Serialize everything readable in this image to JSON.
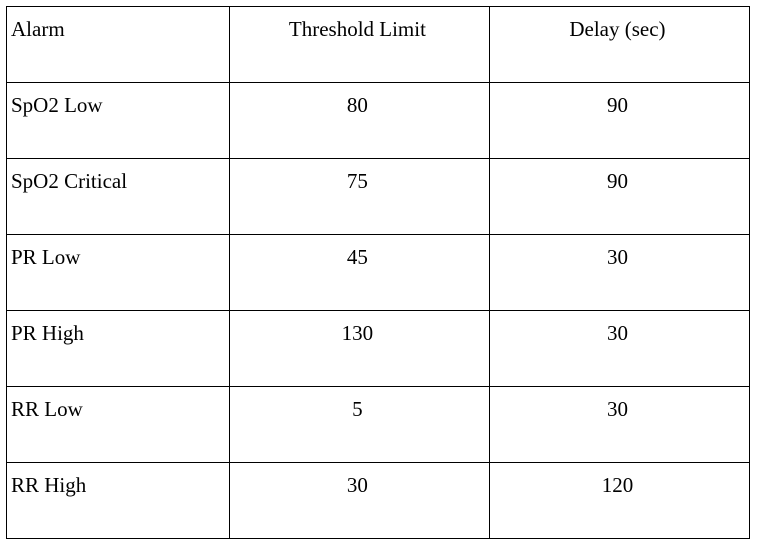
{
  "chart_data": {
    "type": "table",
    "columns": [
      "Alarm",
      "Threshold Limit",
      "Delay (sec)"
    ],
    "rows": [
      {
        "alarm": "SpO2 Low",
        "threshold": "80",
        "delay": "90"
      },
      {
        "alarm": "SpO2 Critical",
        "threshold": "75",
        "delay": "90"
      },
      {
        "alarm": "PR Low",
        "threshold": "45",
        "delay": "30"
      },
      {
        "alarm": "PR High",
        "threshold": "130",
        "delay": "30"
      },
      {
        "alarm": "RR Low",
        "threshold": "5",
        "delay": "30"
      },
      {
        "alarm": "RR High",
        "threshold": "30",
        "delay": "120"
      }
    ]
  }
}
